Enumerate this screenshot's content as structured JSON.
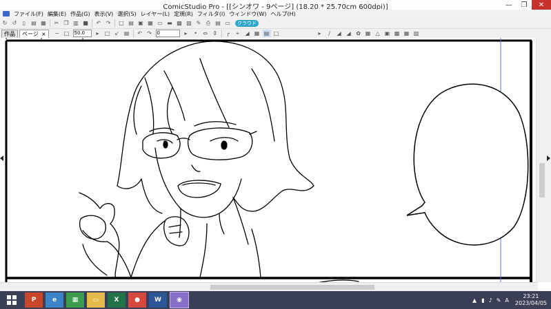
{
  "window": {
    "title": "ComicStudio Pro - [[シンオワ - 9ページ] (18.20 * 25.70cm 600dpi)]",
    "minimize_icon": "minimize-icon",
    "restore_icon": "restore-icon",
    "close_icon": "close-icon"
  },
  "menu": {
    "items": [
      "ファイル(F)",
      "編集(E)",
      "作品(G)",
      "表示(V)",
      "選択(S)",
      "レイヤー(L)",
      "定規(R)",
      "フィルタ(I)",
      "ウィンドウ(W)",
      "ヘルプ(H)"
    ]
  },
  "toolbar": {
    "cloud_badge": "クラウド"
  },
  "tabs": [
    {
      "label": "作品"
    },
    {
      "label": "ページ",
      "close": "×"
    }
  ],
  "view": {
    "zoom": "50.0",
    "rotation": "0"
  },
  "taskbar": {
    "apps": [
      {
        "name": "powerpoint",
        "glyph": "P",
        "color": "#c9462c"
      },
      {
        "name": "edge",
        "glyph": "e",
        "color": "#3b83c7"
      },
      {
        "name": "project",
        "glyph": "▦",
        "color": "#3b9c4b"
      },
      {
        "name": "explorer",
        "glyph": "▭",
        "color": "#e6b84a"
      },
      {
        "name": "excel",
        "glyph": "X",
        "color": "#217346"
      },
      {
        "name": "chrome",
        "glyph": "●",
        "color": "#d8473b"
      },
      {
        "name": "word",
        "glyph": "W",
        "color": "#2b5797"
      },
      {
        "name": "comicstudio",
        "glyph": "◉",
        "color": "#8a6fc9"
      }
    ],
    "ime": "A",
    "time": "23:21",
    "date": "2023/04/05"
  }
}
